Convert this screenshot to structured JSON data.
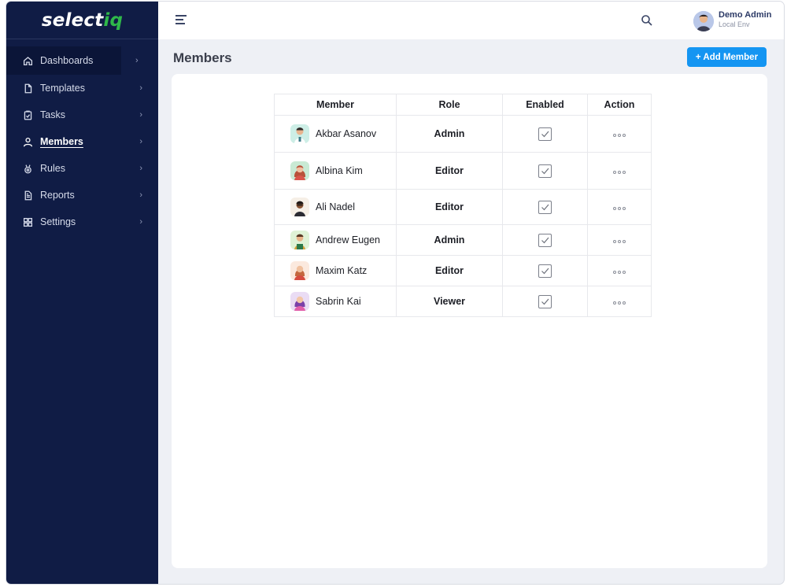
{
  "brand": {
    "name_main": "select",
    "name_accent": "iq",
    "accent_color": "#2fb84a"
  },
  "sidebar": {
    "background": "#101c45",
    "items": [
      {
        "label": "Dashboards",
        "icon": "home-icon"
      },
      {
        "label": "Templates",
        "icon": "file-icon"
      },
      {
        "label": "Tasks",
        "icon": "clipboard-icon"
      },
      {
        "label": "Members",
        "icon": "user-icon",
        "active": true
      },
      {
        "label": "Rules",
        "icon": "medal-icon"
      },
      {
        "label": "Reports",
        "icon": "report-icon"
      },
      {
        "label": "Settings",
        "icon": "grid-icon"
      }
    ],
    "chevron": "›"
  },
  "header": {
    "user_name": "Demo Admin",
    "user_env": "Local Env"
  },
  "page": {
    "title": "Members",
    "add_button": "+ Add Member",
    "accent_color": "#1495f2"
  },
  "table": {
    "columns": [
      "Member",
      "Role",
      "Enabled",
      "Action"
    ],
    "rows": [
      {
        "name": "Akbar Asanov",
        "role": "Admin",
        "enabled": true
      },
      {
        "name": "Albina Kim",
        "role": "Editor",
        "enabled": true
      },
      {
        "name": "Ali Nadel",
        "role": "Editor",
        "enabled": true
      },
      {
        "name": "Andrew Eugen",
        "role": "Admin",
        "enabled": true
      },
      {
        "name": "Maxim Katz",
        "role": "Editor",
        "enabled": true
      },
      {
        "name": "Sabrin Kai",
        "role": "Viewer",
        "enabled": true
      }
    ]
  }
}
